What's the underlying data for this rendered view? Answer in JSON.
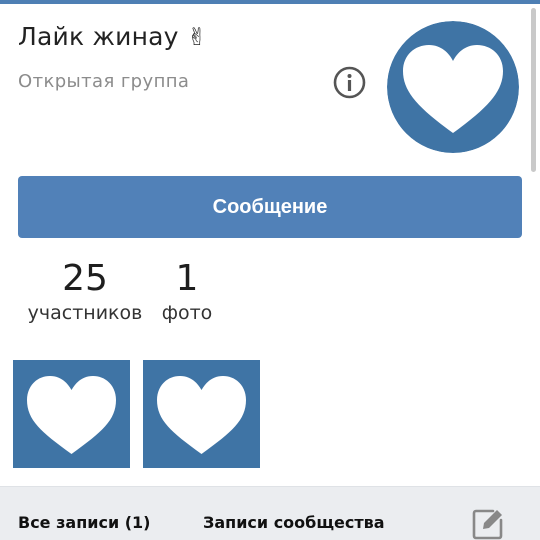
{
  "group": {
    "name": "Лайк жинау",
    "name_emoji": "✌",
    "type": "Открытая группа"
  },
  "actions": {
    "message_label": "Сообщение"
  },
  "counters": {
    "members_value": "25",
    "members_label": "участников",
    "photos_value": "1",
    "photos_label": "фото"
  },
  "tabs": {
    "all_posts": "Все записи (1)",
    "community_posts": "Записи сообщества"
  },
  "icons": {
    "info": "info-icon",
    "edit": "edit-icon",
    "avatar": "heart-icon"
  },
  "colors": {
    "accent": "#5181b8",
    "heart_background": "#3f74a5",
    "tabs_background": "#ebedf0"
  }
}
